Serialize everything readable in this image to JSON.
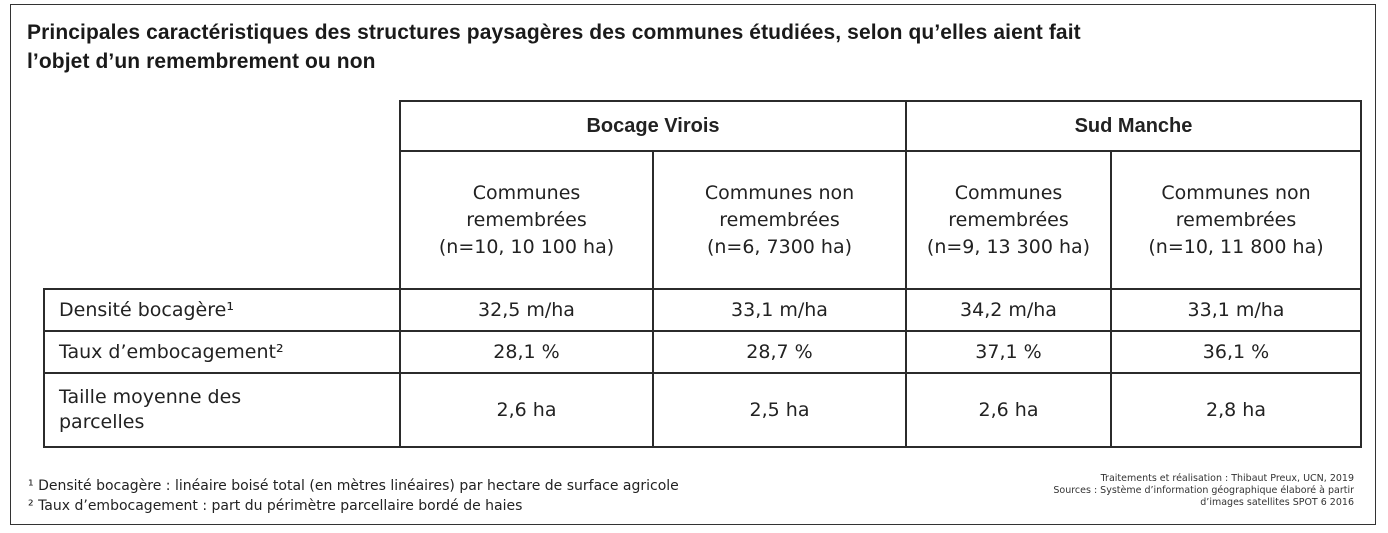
{
  "title": {
    "line1": "Principales caractéristiques des structures paysagères des communes étudiées, selon qu’elles aient fait",
    "line2": "l’objet d’un remembrement ou non"
  },
  "table": {
    "groups": [
      "Bocage Virois",
      "Sud Manche"
    ],
    "columns": [
      {
        "line1": "Communes",
        "line2": "remembrées",
        "line3": "(n=10, 10 100 ha)"
      },
      {
        "line1": "Communes non",
        "line2": "remembrées",
        "line3": "(n=6, 7300 ha)"
      },
      {
        "line1": "Communes",
        "line2": "remembrées",
        "line3": "(n=9, 13 300 ha)"
      },
      {
        "line1": "Communes non",
        "line2": "remembrées",
        "line3": "(n=10, 11 800 ha)"
      }
    ],
    "rows": [
      {
        "label": "Densité bocagère¹",
        "label2": "",
        "values": [
          "32,5 m/ha",
          "33,1 m/ha",
          "34,2 m/ha",
          "33,1 m/ha"
        ]
      },
      {
        "label": "Taux d’embocagement²",
        "label2": "",
        "values": [
          "28,1 %",
          "28,7 %",
          "37,1 %",
          "36,1 %"
        ]
      },
      {
        "label": "Taille moyenne des",
        "label2": "parcelles",
        "values": [
          "2,6 ha",
          "2,5 ha",
          "2,6 ha",
          "2,8 ha"
        ]
      }
    ]
  },
  "footnotes": [
    "¹ Densité bocagère : linéaire boisé total (en mètres linéaires) par hectare de surface agricole",
    "² Taux d’embocagement : part du périmètre parcellaire bordé de haies"
  ],
  "credits": [
    "Traitements et réalisation : Thibaut Preux, UCN, 2019",
    "Sources : Système d’information géographique élaboré à partir",
    "d’images satellites SPOT 6 2016"
  ]
}
